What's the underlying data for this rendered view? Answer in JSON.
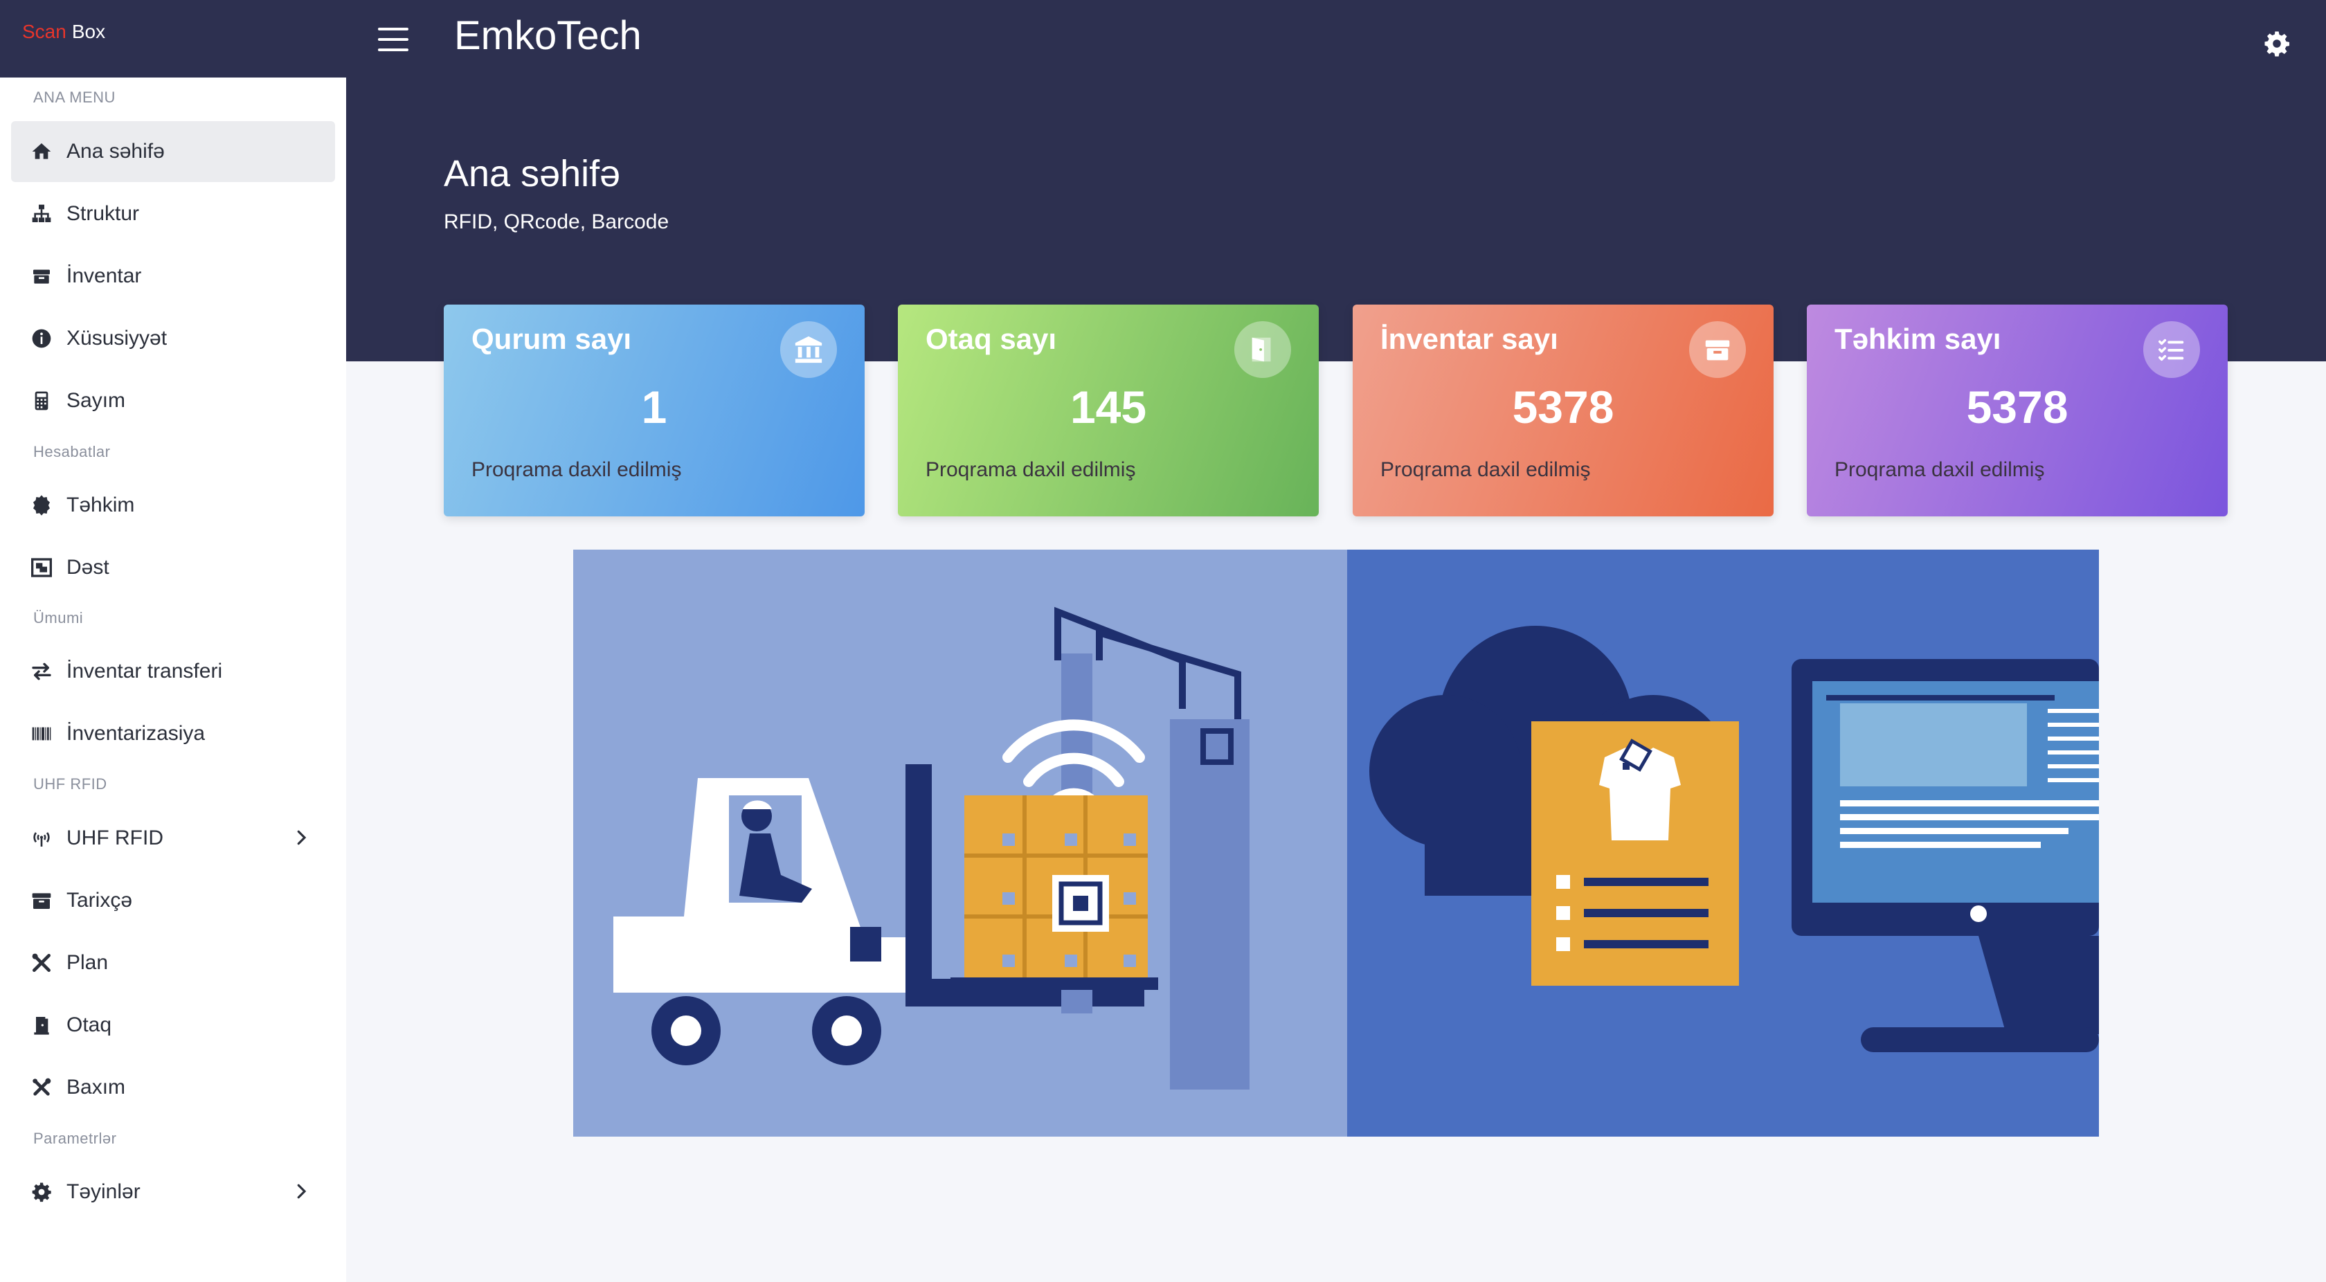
{
  "brand": {
    "part1": "Scan",
    "part2": "Box"
  },
  "header": {
    "app_title": "EmkoTech"
  },
  "page": {
    "title": "Ana səhifə",
    "subtitle": "RFID, QRcode, Barcode"
  },
  "sidebar": {
    "sections": [
      "ANA MENU",
      "Hesabatlar",
      "Ümumi",
      "UHF RFID",
      "Parametrlər"
    ],
    "items": [
      {
        "label": "Ana səhifə",
        "icon": "home-icon",
        "active": true
      },
      {
        "label": "Struktur",
        "icon": "sitemap-icon"
      },
      {
        "label": "İnventar",
        "icon": "box-icon"
      },
      {
        "label": "Xüsusiyyət",
        "icon": "info-icon"
      },
      {
        "label": "Sayım",
        "icon": "calculator-icon"
      },
      {
        "label": "Təhkim",
        "icon": "certificate-icon"
      },
      {
        "label": "Dəst",
        "icon": "object-group-icon"
      },
      {
        "label": "İnventar transferi",
        "icon": "exchange-icon"
      },
      {
        "label": "İnventarizasiya",
        "icon": "barcode-icon"
      },
      {
        "label": "UHF RFID",
        "icon": "antenna-icon",
        "expandable": true
      },
      {
        "label": "Tarixçə",
        "icon": "archive-icon"
      },
      {
        "label": "Plan",
        "icon": "drafting-tools-icon"
      },
      {
        "label": "Otaq",
        "icon": "door-icon"
      },
      {
        "label": "Baxım",
        "icon": "tools-icon"
      },
      {
        "label": "Təyinlər",
        "icon": "gear-icon",
        "expandable": true
      }
    ]
  },
  "cards": [
    {
      "title": "Qurum sayı",
      "value": "1",
      "desc": "Proqrama daxil edilmiş",
      "icon": "institution-icon"
    },
    {
      "title": "Otaq sayı",
      "value": "145",
      "desc": "Proqrama daxil edilmiş",
      "icon": "door-open-icon"
    },
    {
      "title": "İnventar sayı",
      "value": "5378",
      "desc": "Proqrama daxil edilmiş",
      "icon": "box-icon"
    },
    {
      "title": "Təhkim sayı",
      "value": "5378",
      "desc": "Proqrama daxil edilmiş",
      "icon": "task-list-icon"
    }
  ],
  "colors": {
    "header_bg": "#2d3050",
    "brand_accent": "#e8352b",
    "card1": "#4e98e8",
    "card2": "#68b359",
    "card3": "#ea6a45",
    "card4": "#7b55dd"
  }
}
